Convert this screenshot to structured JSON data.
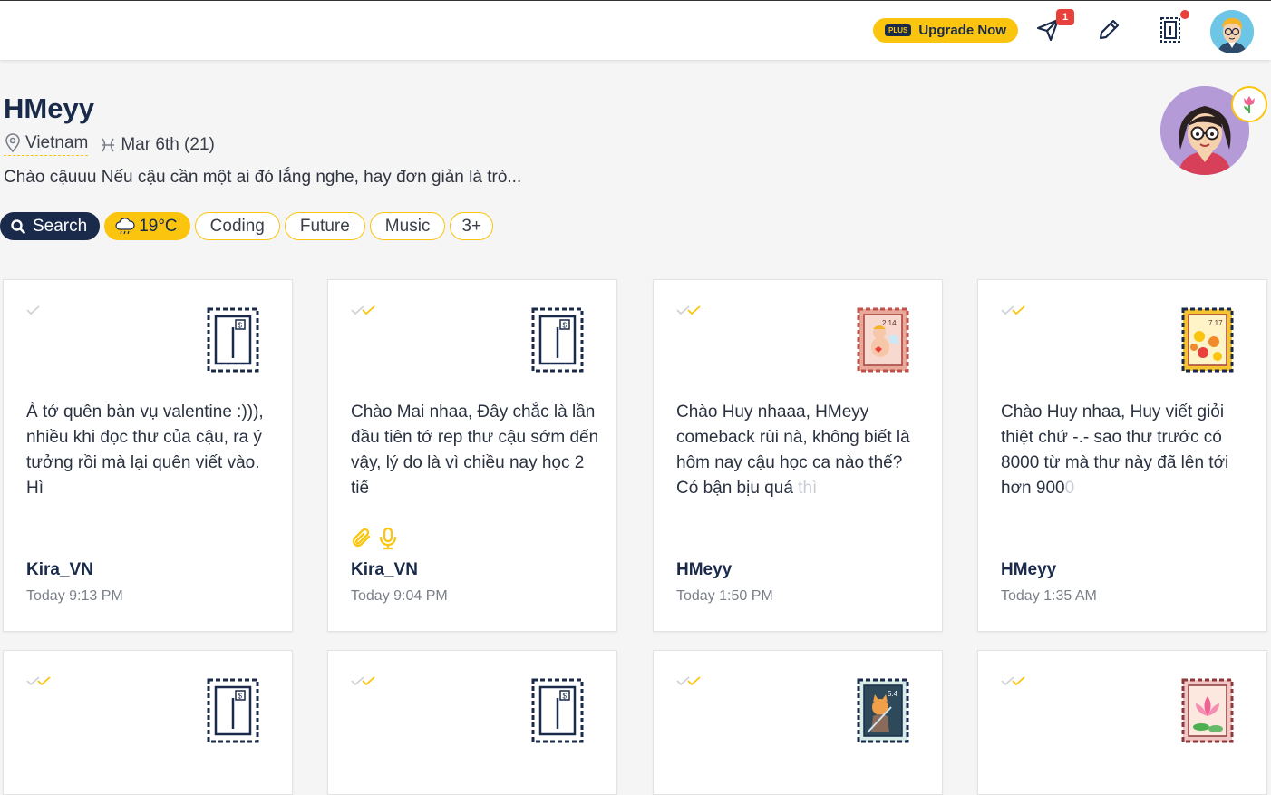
{
  "header": {
    "upgrade_plus": "PLUS",
    "upgrade_label": "Upgrade Now",
    "notification_count": "1"
  },
  "profile": {
    "name": "HMeyy",
    "location": "Vietnam",
    "birthday": "Mar 6th (21)",
    "bio": "Chào cậuuu Nếu cậu cần một ai đó lắng nghe, hay đơn giản là trò...",
    "search_label": "Search",
    "weather": "19°C",
    "interests": [
      "Coding",
      "Future",
      "Music",
      "3+"
    ]
  },
  "colors": {
    "accent": "#fbc50f",
    "navy": "#1a2a4a",
    "alert": "#e8403a"
  },
  "letters": [
    {
      "text": "À tớ quên bàn vụ valentine :))), nhiều khi đọc thư của cậu, ra ý tưởng rồi mà lại quên viết vào. Hì",
      "text_fade": "",
      "author": "Kira_VN",
      "time": "Today 9:13 PM",
      "stamp": "default-stamp-icon",
      "read": false
    },
    {
      "text": "Chào Mai nhaa, Đây chắc là lần đầu tiên tớ rep thư cậu sớm đến vậy, lý do là vì chiều nay học 2 tiế",
      "text_fade": "",
      "author": "Kira_VN",
      "time": "Today 9:04 PM",
      "stamp": "default-stamp-icon",
      "read": true,
      "attachments": [
        "paperclip-icon",
        "microphone-icon"
      ]
    },
    {
      "text": "Chào Huy nhaaa, HMeyy comeback rùi nà, không biết là hôm nay cậu học ca nào thế? Có bận bịu quá ",
      "text_fade": "thì",
      "author": "HMeyy",
      "time": "Today 1:50 PM",
      "stamp": "cupid-stamp-icon",
      "stamp_date": "2.14",
      "read": true
    },
    {
      "text": "Chào Huy nhaa, Huy viết giỏi thiệt chứ -.- sao thư trước có 8000 từ mà thư này đã lên tới hơn 900",
      "text_fade": "0",
      "author": "HMeyy",
      "time": "Today 1:35 AM",
      "stamp": "emoji-stamp-icon",
      "stamp_date": "7.17",
      "read": true
    },
    {
      "stamp": "default-stamp-icon",
      "read": true
    },
    {
      "stamp": "default-stamp-icon",
      "read": true
    },
    {
      "stamp": "cat-stamp-icon",
      "stamp_date": "5.4",
      "read": true
    },
    {
      "stamp": "lotus-stamp-icon",
      "read": true
    }
  ]
}
